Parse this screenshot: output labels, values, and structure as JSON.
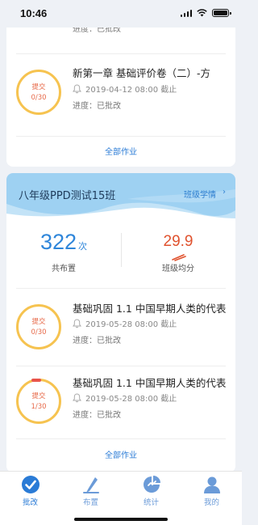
{
  "status_bar": {
    "time": "10:46"
  },
  "card_top": {
    "partial_item": {
      "progress": "进度：已批改"
    },
    "item": {
      "title": "新第一章 基础评价卷（二）-方",
      "submit_label": "提交",
      "submit_count": "0/30",
      "deadline": "2019-04-12 08:00 截止",
      "progress": "进度：已批改"
    },
    "view_all": "全部作业"
  },
  "class_card": {
    "class_name": "八年级PPD测试15班",
    "class_link": "班级学情",
    "class_link_chevron": "›",
    "stats": {
      "assigned_value": "322",
      "assigned_unit": "次",
      "assigned_label": "共布置",
      "avg_score": "29.9",
      "avg_label": "班级均分"
    },
    "items": [
      {
        "title": "基础巩固 1.1 中国早期人类的代表",
        "submit_label": "提交",
        "submit_count": "0/30",
        "deadline": "2019-05-28 08:00 截止",
        "progress": "进度：已批改"
      },
      {
        "title": "基础巩固 1.1 中国早期人类的代表",
        "submit_label": "提交",
        "submit_count": "1/30",
        "deadline": "2019-05-28 08:00 截止",
        "progress": "进度：已批改"
      }
    ],
    "view_all": "全部作业"
  },
  "tab_bar": {
    "tabs": [
      {
        "label": "批改",
        "icon": "check-circle-icon"
      },
      {
        "label": "布置",
        "icon": "pencil-icon"
      },
      {
        "label": "统计",
        "icon": "chart-icon"
      },
      {
        "label": "我的",
        "icon": "user-icon"
      }
    ],
    "active_color": "#2a7bd6",
    "inactive_color": "#6b9bd8"
  },
  "colors": {
    "ring": "#f6c350",
    "submit_text": "#e76a4a",
    "link": "#2a7bd6",
    "score": "#e0522e",
    "header_bg": "#9ed1f2"
  }
}
